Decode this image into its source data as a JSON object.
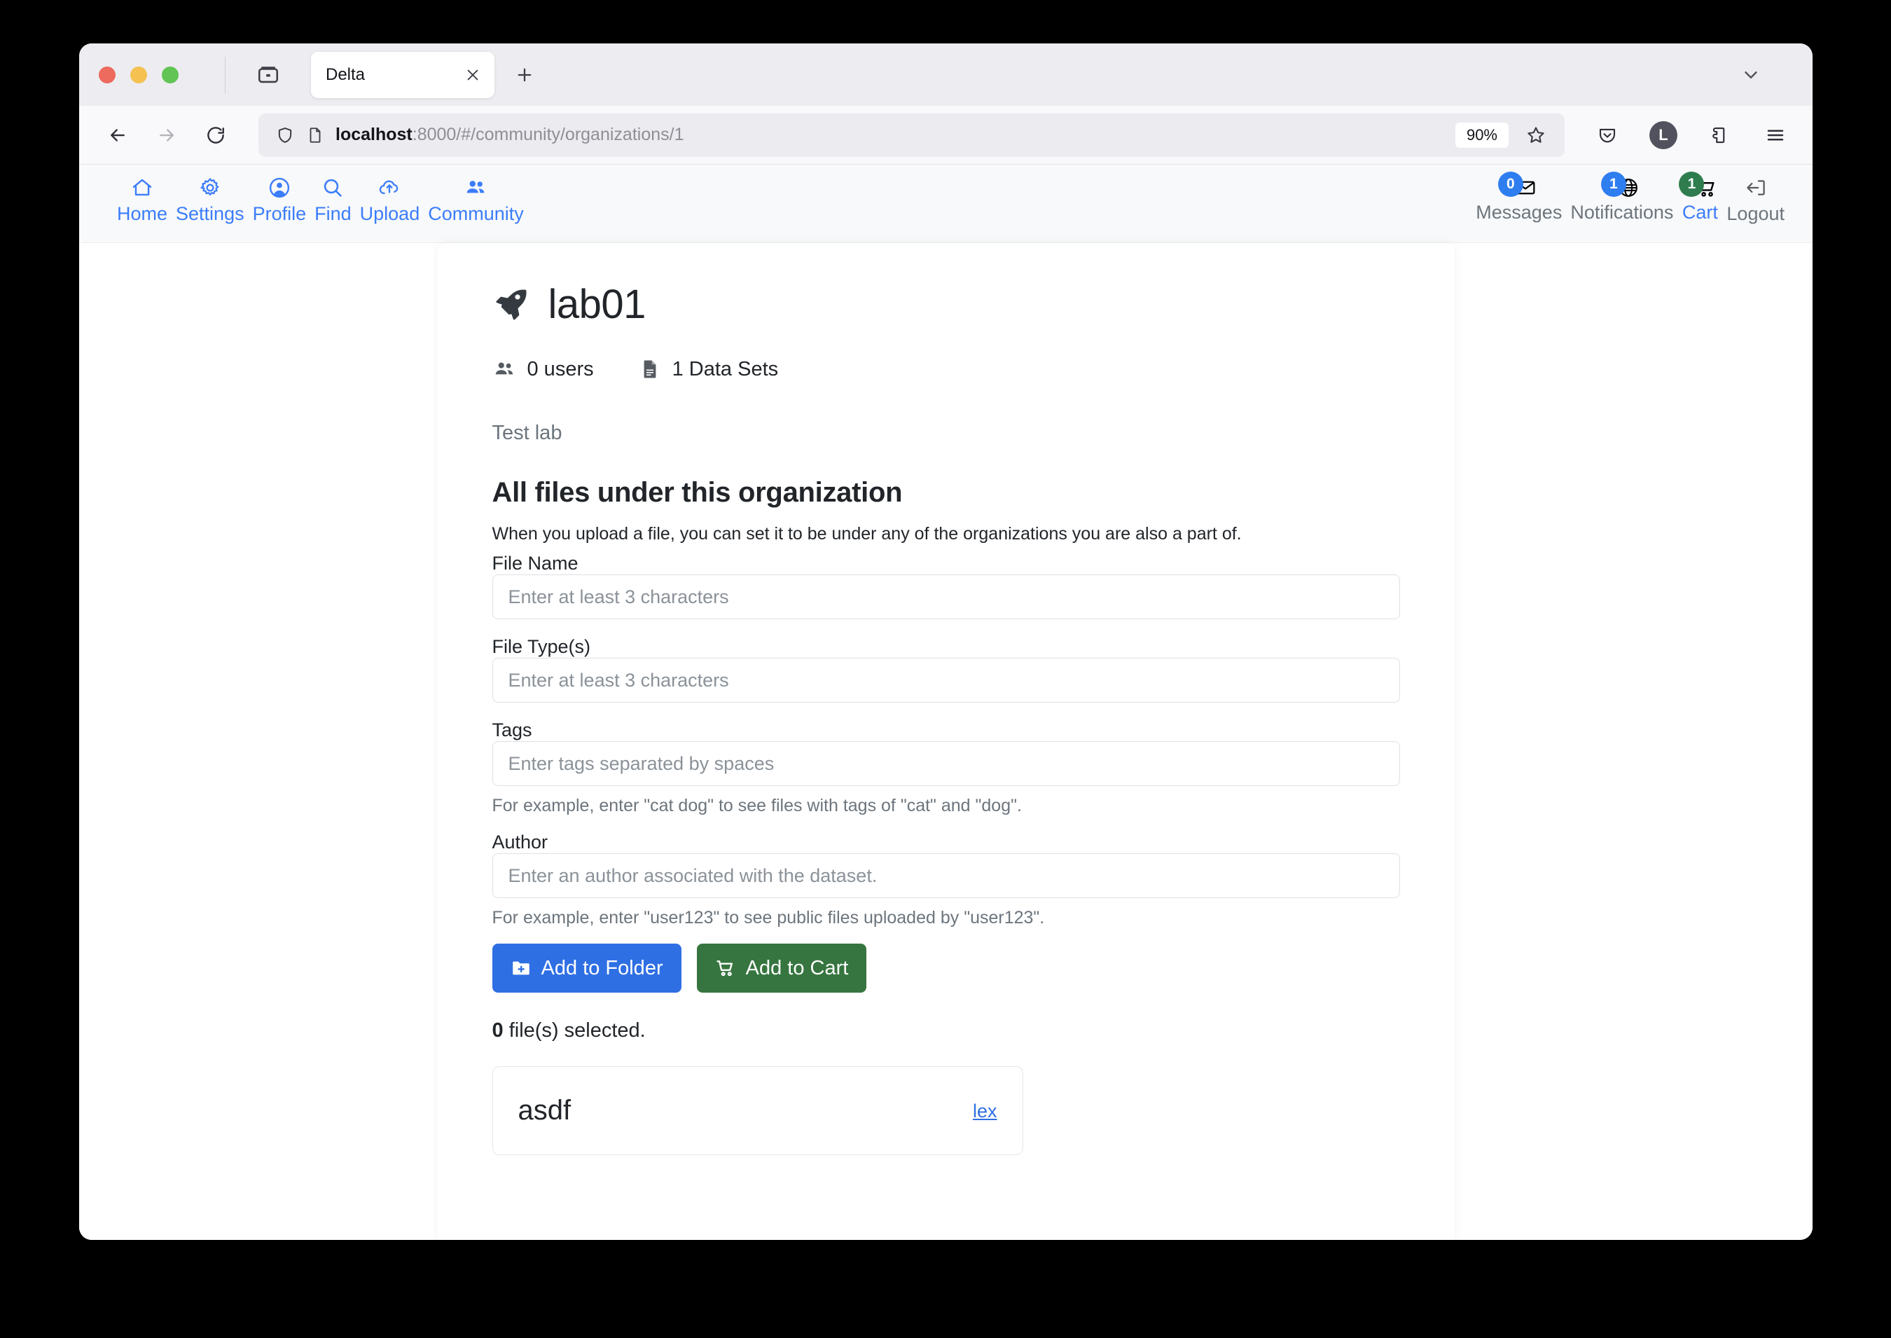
{
  "browser": {
    "tab": {
      "title": "Delta",
      "close_label": "×"
    },
    "new_tab_label": "+",
    "url": {
      "host": "localhost",
      "rest": ":8000/#/community/organizations/1",
      "full": "localhost:8000/#/community/organizations/1"
    },
    "zoom_level": "90%",
    "account_initial": "L"
  },
  "app_nav": {
    "left_items": [
      {
        "label": "Home",
        "icon": "home-icon"
      },
      {
        "label": "Settings",
        "icon": "gear-icon"
      },
      {
        "label": "Profile",
        "icon": "person-circle-icon"
      },
      {
        "label": "Find",
        "icon": "search-icon"
      },
      {
        "label": "Upload",
        "icon": "cloud-upload-icon"
      },
      {
        "label": "Community",
        "icon": "people-icon"
      }
    ],
    "right_items": [
      {
        "label": "Messages",
        "icon": "envelope-icon",
        "badge": "0",
        "badge_color": "#2f7ef0",
        "active": false
      },
      {
        "label": "Notifications",
        "icon": "globe-icon",
        "badge": "1",
        "badge_color": "#2f7ef0",
        "active": false
      },
      {
        "label": "Cart",
        "icon": "cart-icon",
        "badge": "1",
        "badge_color": "#2f7d4f",
        "active": true
      },
      {
        "label": "Logout",
        "icon": "logout-icon",
        "badge": null,
        "badge_color": null,
        "active": false
      }
    ]
  },
  "organization": {
    "icon": "rocket-icon",
    "name": "lab01",
    "users_stat": "0 users",
    "datasets_stat": "1 Data Sets",
    "description": "Test lab"
  },
  "files_section": {
    "heading": "All files under this organization",
    "subheading": "When you upload a file, you can set it to be under any of the organizations you are also a part of.",
    "fields": [
      {
        "label": "File Name",
        "placeholder": "Enter at least 3 characters",
        "value": "",
        "hint": null
      },
      {
        "label": "File Type(s)",
        "placeholder": "Enter at least 3 characters",
        "value": "",
        "hint": null
      },
      {
        "label": "Tags",
        "placeholder": "Enter tags separated by spaces",
        "value": "",
        "hint": "For example, enter \"cat dog\" to see files with tags of \"cat\" and \"dog\"."
      },
      {
        "label": "Author",
        "placeholder": "Enter an author associated with the dataset.",
        "value": "",
        "hint": "For example, enter \"user123\" to see public files uploaded by \"user123\"."
      }
    ],
    "buttons": [
      {
        "label": "Add to Folder",
        "icon": "folder-plus-icon",
        "color": "#2f6fe4"
      },
      {
        "label": "Add to Cart",
        "icon": "cart-icon",
        "color": "#36753f"
      }
    ],
    "selected_count_value": "0",
    "selected_count_suffix": " file(s) selected.",
    "results": [
      {
        "name": "asdf",
        "author_link": "lex"
      }
    ]
  },
  "colors": {
    "nav_blue": "#3b7dfa",
    "link_blue": "#2f6fe4",
    "success_green": "#36753f",
    "badge_green": "#2f7d4f",
    "muted_text": "#6c757d"
  }
}
